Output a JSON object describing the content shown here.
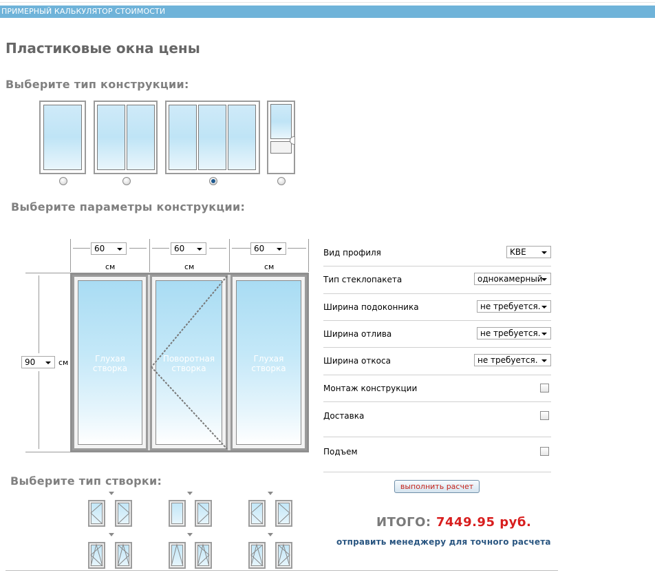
{
  "header": {
    "bar_title": "ПРИМЕРНЫЙ КАЛЬКУЛЯТОР СТОИМОСТИ",
    "page_title": "Пластиковые окна цены"
  },
  "sections": {
    "construction_type": "Выберите тип конструкции:",
    "construction_params": "Выберите параметры конструкции:",
    "sash_type": "Выберите тип створки:"
  },
  "construction_types": [
    {
      "panes": 1,
      "selected": false
    },
    {
      "panes": 2,
      "selected": false
    },
    {
      "panes": 3,
      "selected": true
    },
    {
      "panes": "balcony-door",
      "selected": false
    }
  ],
  "dimensions": {
    "widths": [
      "60",
      "60",
      "60"
    ],
    "height": "90",
    "unit": "см"
  },
  "sashes": [
    {
      "label_line1": "Глухая",
      "label_line2": "створка"
    },
    {
      "label_line1": "Поворотная",
      "label_line2": "створка"
    },
    {
      "label_line1": "Глухая",
      "label_line2": "створка"
    }
  ],
  "params": [
    {
      "label": "Вид профиля",
      "type": "select",
      "value": "KBE"
    },
    {
      "label": "Тип стеклопакета",
      "type": "select",
      "value": "однокамерный"
    },
    {
      "label": "Ширина подоконника",
      "type": "select",
      "value": "не требуется."
    },
    {
      "label": "Ширина отлива",
      "type": "select",
      "value": "не требуется."
    },
    {
      "label": "Ширина откоса",
      "type": "select",
      "value": "не требуется."
    },
    {
      "label": "Монтаж конструкции",
      "type": "checkbox",
      "checked": false
    },
    {
      "label": "Доставка",
      "type": "checkbox",
      "checked": false
    },
    {
      "label": "Подъем",
      "type": "checkbox",
      "checked": false
    }
  ],
  "actions": {
    "calculate": "выполнить расчет",
    "send": "отправить менеджеру для точного расчета"
  },
  "total": {
    "label": "ИТОГО:",
    "value": "7449.95 руб."
  },
  "colors": {
    "bar": "#6fb3d9",
    "total": "#d81e1e",
    "link": "#2a5681"
  }
}
